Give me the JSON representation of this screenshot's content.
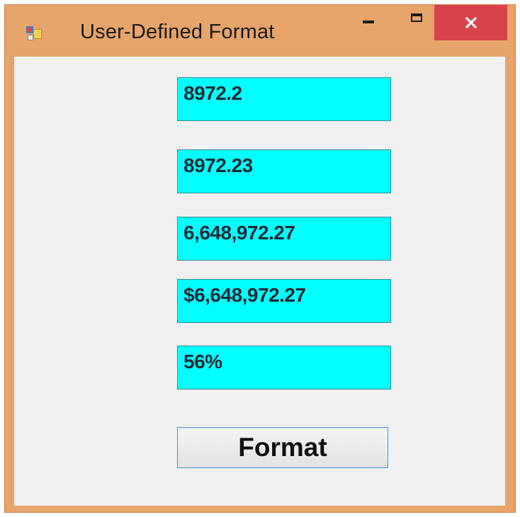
{
  "window": {
    "title": "User-Defined Format",
    "app_icon": "form-app-icon",
    "controls": {
      "minimize_icon": "minimize-icon",
      "maximize_icon": "maximize-icon",
      "close_icon": "close-icon"
    },
    "colors": {
      "frame": "#e6a46a",
      "close_button": "#d9434b",
      "client": "#f0f0f0"
    }
  },
  "form": {
    "fields": [
      {
        "value": "8972.2"
      },
      {
        "value": "8972.23"
      },
      {
        "value": "6,648,972.27"
      },
      {
        "value": "$6,648,972.27"
      },
      {
        "value": "56%"
      }
    ],
    "field_color": "#00ffff",
    "format_button_label": "Format"
  }
}
